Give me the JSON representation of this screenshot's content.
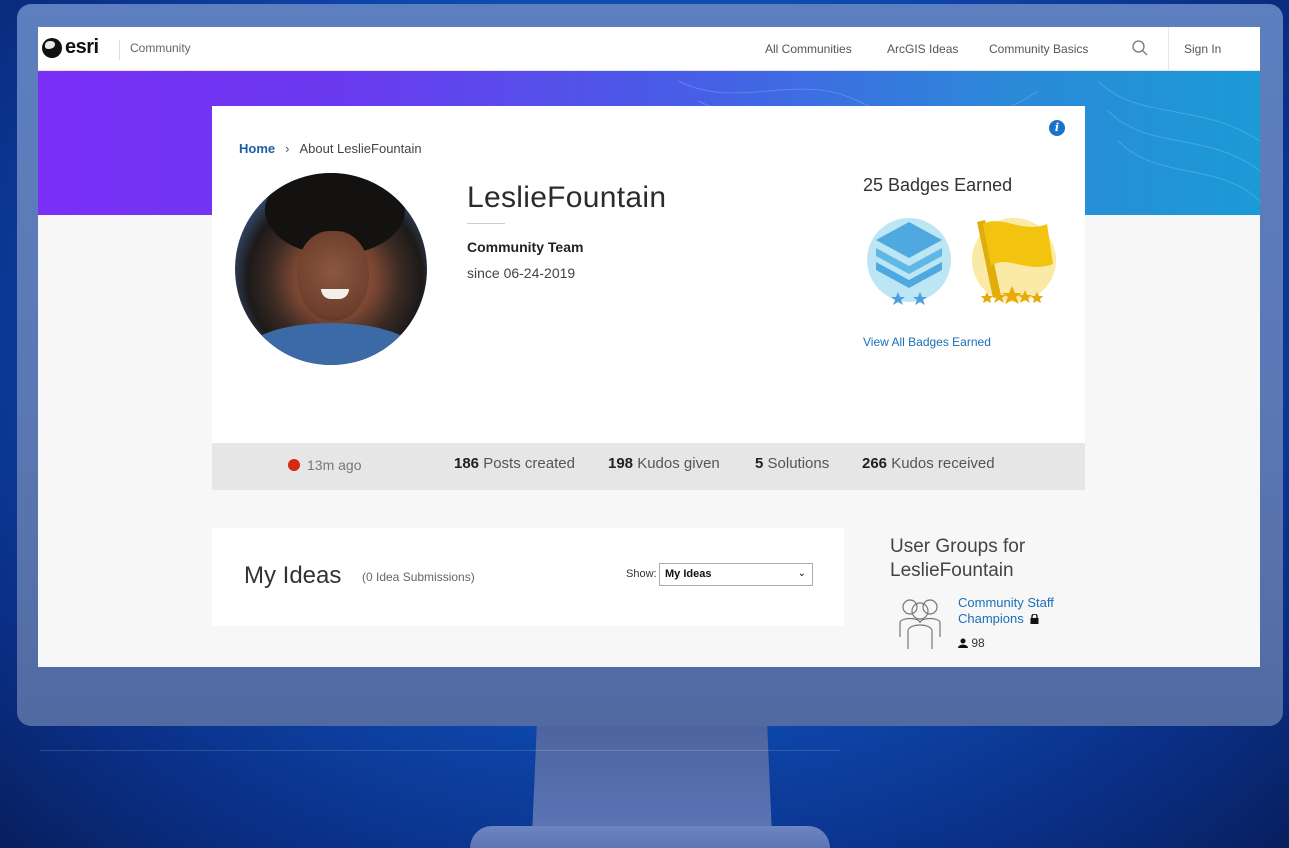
{
  "nav": {
    "logo_text": "esri",
    "community_label": "Community",
    "links": [
      "All Communities",
      "ArcGIS Ideas",
      "Community Basics"
    ],
    "sign_in": "Sign In"
  },
  "breadcrumb": {
    "home": "Home",
    "separator": "›",
    "current": "About LeslieFountain"
  },
  "profile": {
    "username": "LeslieFountain",
    "role": "Community Team",
    "since": "since 06-24-2019",
    "status_color": "#d42a12",
    "last_seen": "13m ago"
  },
  "badges": {
    "title": "25 Badges Earned",
    "view_all": "View All Badges Earned",
    "items": [
      {
        "icon": "layers-badge-icon",
        "color": "#5fb8e6",
        "stars": 2
      },
      {
        "icon": "flag-badge-icon",
        "color": "#f2c40f",
        "stars": 5
      }
    ]
  },
  "stats": {
    "posts_count": "186",
    "posts_label": "Posts created",
    "kudos_given_count": "198",
    "kudos_given_label": "Kudos given",
    "solutions_count": "5",
    "solutions_label": "Solutions",
    "kudos_received_count": "266",
    "kudos_received_label": "Kudos received"
  },
  "ideas": {
    "title": "My Ideas",
    "count_label": "(0 Idea Submissions)",
    "show_label": "Show:",
    "selected": "My Ideas"
  },
  "groups": {
    "title": "User Groups for LeslieFountain",
    "items": [
      {
        "name": "Community Staff Champions",
        "members": "98"
      }
    ]
  },
  "colors": {
    "link": "#1a6fb8",
    "hero_start": "#7b2ff7",
    "hero_end": "#1b9ad6"
  }
}
